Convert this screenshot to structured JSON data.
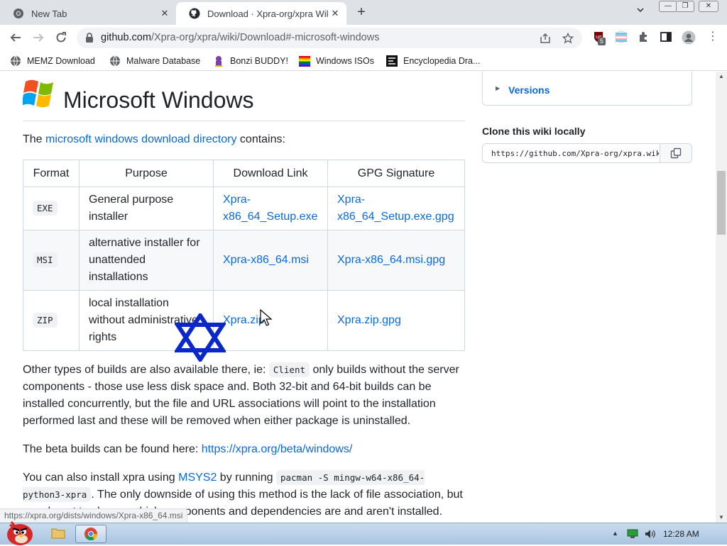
{
  "browser": {
    "tabs": [
      {
        "title": "New Tab"
      },
      {
        "title": "Download · Xpra-org/xpra Wiki"
      }
    ],
    "new_tab_symbol": "+",
    "address": {
      "host": "github.com",
      "path": "/Xpra-org/xpra/wiki/Download#-microsoft-windows"
    },
    "extension_badge": "5",
    "bookmarks": [
      {
        "label": "MEMZ Download",
        "icon": "globe-icon"
      },
      {
        "label": "Malware Database",
        "icon": "globe-icon"
      },
      {
        "label": "Bonzi BUDDY!",
        "icon": "bonzi-icon"
      },
      {
        "label": "Windows ISOs",
        "icon": "windows-flag-icon"
      },
      {
        "label": "Encyclopedia Dra...",
        "icon": "encyclopedia-icon"
      }
    ]
  },
  "page": {
    "heading": "Microsoft Windows",
    "intro": {
      "before": "The ",
      "link": "microsoft windows download directory",
      "after": " contains:"
    },
    "table": {
      "headers": [
        "Format",
        "Purpose",
        "Download Link",
        "GPG Signature"
      ],
      "rows": [
        {
          "format": "EXE",
          "purpose": "General purpose installer",
          "link": "Xpra-x86_64_Setup.exe",
          "sig": "Xpra-x86_64_Setup.exe.gpg"
        },
        {
          "format": "MSI",
          "purpose": "alternative installer for unattended installations",
          "link": "Xpra-x86_64.msi",
          "sig": "Xpra-x86_64.msi.gpg"
        },
        {
          "format": "ZIP",
          "purpose": "local installation without administrative rights",
          "link": "Xpra.zip",
          "sig": "Xpra.zip.gpg"
        }
      ]
    },
    "p_other": {
      "before": "Other types of builds are also available there, ie: ",
      "code": "Client",
      "after": " only builds without the server components - those use less disk space and. Both 32-bit and 64-bit builds can be installed concurrently, but the file and URL associations will point to the installation performed last and these will be removed when either package is uninstalled."
    },
    "p_beta": {
      "before": "The beta builds can be found here: ",
      "link": "https://xpra.org/beta/windows/"
    },
    "p_msys": {
      "before": "You can also install xpra using ",
      "link": "MSYS2",
      "mid": " by running ",
      "code": "pacman -S mingw-w64-x86_64-python3-xpra",
      "after": ". The only downside of using this method is the lack of file association, but you do get to choose which components and dependencies are and aren't installed."
    }
  },
  "sidebar": {
    "versions_label": "Versions",
    "clone_label": "Clone this wiki locally",
    "clone_url": "https://github.com/Xpra-org/xpra.wiki.git"
  },
  "status_url": "https://xpra.org/dists/windows/Xpra-x86_64.msi",
  "taskbar": {
    "clock": "12:28 AM"
  },
  "colors": {
    "link": "#0969da",
    "star": "#0a28c8",
    "tabbar": "#dee1e6"
  }
}
